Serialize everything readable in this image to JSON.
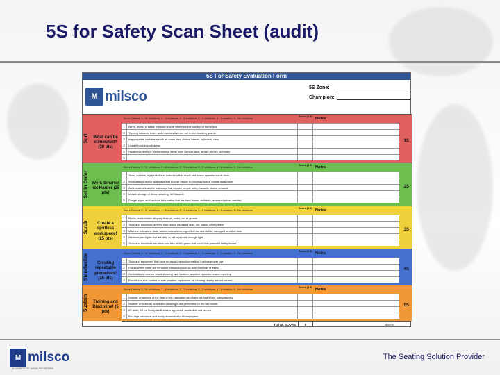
{
  "slide": {
    "title": "5S for Safety Scan Sheet (audit)",
    "tagline": "The Seating Solution Provider",
    "footer_logo": "milsco",
    "footer_small": "A DIVISION OF JASON INDUSTRIES"
  },
  "form": {
    "title": "5S For Safety Evaluation Form",
    "logo": "milsco",
    "zone_label": "5S Zone:",
    "champion_label": "Champion:",
    "score_header": "Score (0-5)",
    "notes_header": "Notes",
    "total_label": "TOTAL SCORE",
    "total_value": "0",
    "total_extra": "#DIV/0!",
    "sections": [
      {
        "side": "Sort",
        "goal": "What can be eliminated? (30 pts)",
        "criteria": "Score Criteria: 0 - 5+ violations, 1 - 4 violations, 2 - 3 violations, 3 - 2 violations, 4 - 1 violation, 5 - No violations",
        "total": "1S",
        "items": [
          "Wires, pipes, or tubes exposed or wire where people can trip or bump into",
          "Tripping hazards, trash, and materials that are not in use blocking guards",
          "Inappropriate containers such as scrap bins, drums, barrels, cylinders, cans",
          "Unsafe tools in work areas",
          "Hazardous items or environmental items such as heat, dust, smoke, fumes, or fumes",
          ""
        ]
      },
      {
        "side": "Set In Order",
        "goal": "Work Smarter not Harder (25 pts)",
        "criteria": "Score Criteria: 0 - 5+ violations, 1 - 4 violations, 2 - 3 violations, 3 - 2 violations, 4 - 1 violation, 5 - No violations",
        "total": "2S",
        "items": [
          "Tools, controls, equipment and material within reach and where operator wants them",
          "Workstations and/or walkways that expose people to moving parts or mobile equipment",
          "Work materials and/or walkways that expose people to trip hazards, doors, exhaust",
          "Unsafe storage of items, stacking, fall hazards",
          "Danger signs and/or visual information that are hard to see, visible to personnel where needed"
        ]
      },
      {
        "side": "Scrub",
        "goal": "Create a spotless workspace! (25 pts)",
        "criteria": "Score Criteria: 0 - 5+ violations, 1 - 4 violations, 2 - 3 violations, 3 - 2 violations, 4 - 1 violation, 5 - No violations",
        "total": "3S",
        "items": [
          "Floors, walls hidden slippery from oil, water, dirt or grease",
          "Tools and machines cleaned that shows displaced dust, dirt, water, oil or grease",
          "Machine indicators, dials, labels, instructions, signs that are not visible, damaged or out of date",
          "Windows and lights that are dirty or fail to provide enough light",
          "Tools and machines are clean and free of dirt, grime that could hide potential safety issues"
        ]
      },
      {
        "side": "Standardize",
        "goal": "Creating repeatable processes! (15 pts)",
        "criteria": "Score Criteria: 0 - 5+ violations, 1 - 4 violations, 2 - 3 violations, 3 - 2 violations, 4 - 1 violation, 5 - No violations",
        "total": "4S",
        "items": [
          "Tools and equipment that have no visual instruction method to show proper use",
          "Places where there are no visible indicators such as floor markings or signs",
          "Workstations have no visual showing rack location, accident procedures and reporting",
          "Procedures that confirm to safe practice, equipment, or cleaning priority are not current"
        ]
      },
      {
        "side": "Sustain",
        "goal": "Training and Discipline! (5 pts)",
        "criteria": "Score Criteria: 0 - 5+ violations, 1 - 4 violations, 2 - 3 violations, 3 - 2 violations, 4 - 1 violation, 5 - No violations",
        "total": "5S",
        "items": [
          "Number of workers at the time of this evaluation who have not had 5S for safety training",
          "Number of times as scheduled cleaning is not performed for the last month",
          "5S audit, 5S for Safety audit sheets approved, accessible and current",
          "Red tags are visual and easily accessible to all employees"
        ]
      }
    ]
  },
  "colors": {
    "sort": "#e06060",
    "set_in_order": "#6cbf4f",
    "scrub": "#f0d03c",
    "standardize": "#4470d0",
    "sustain": "#f09838",
    "brand": "#2f5597"
  }
}
